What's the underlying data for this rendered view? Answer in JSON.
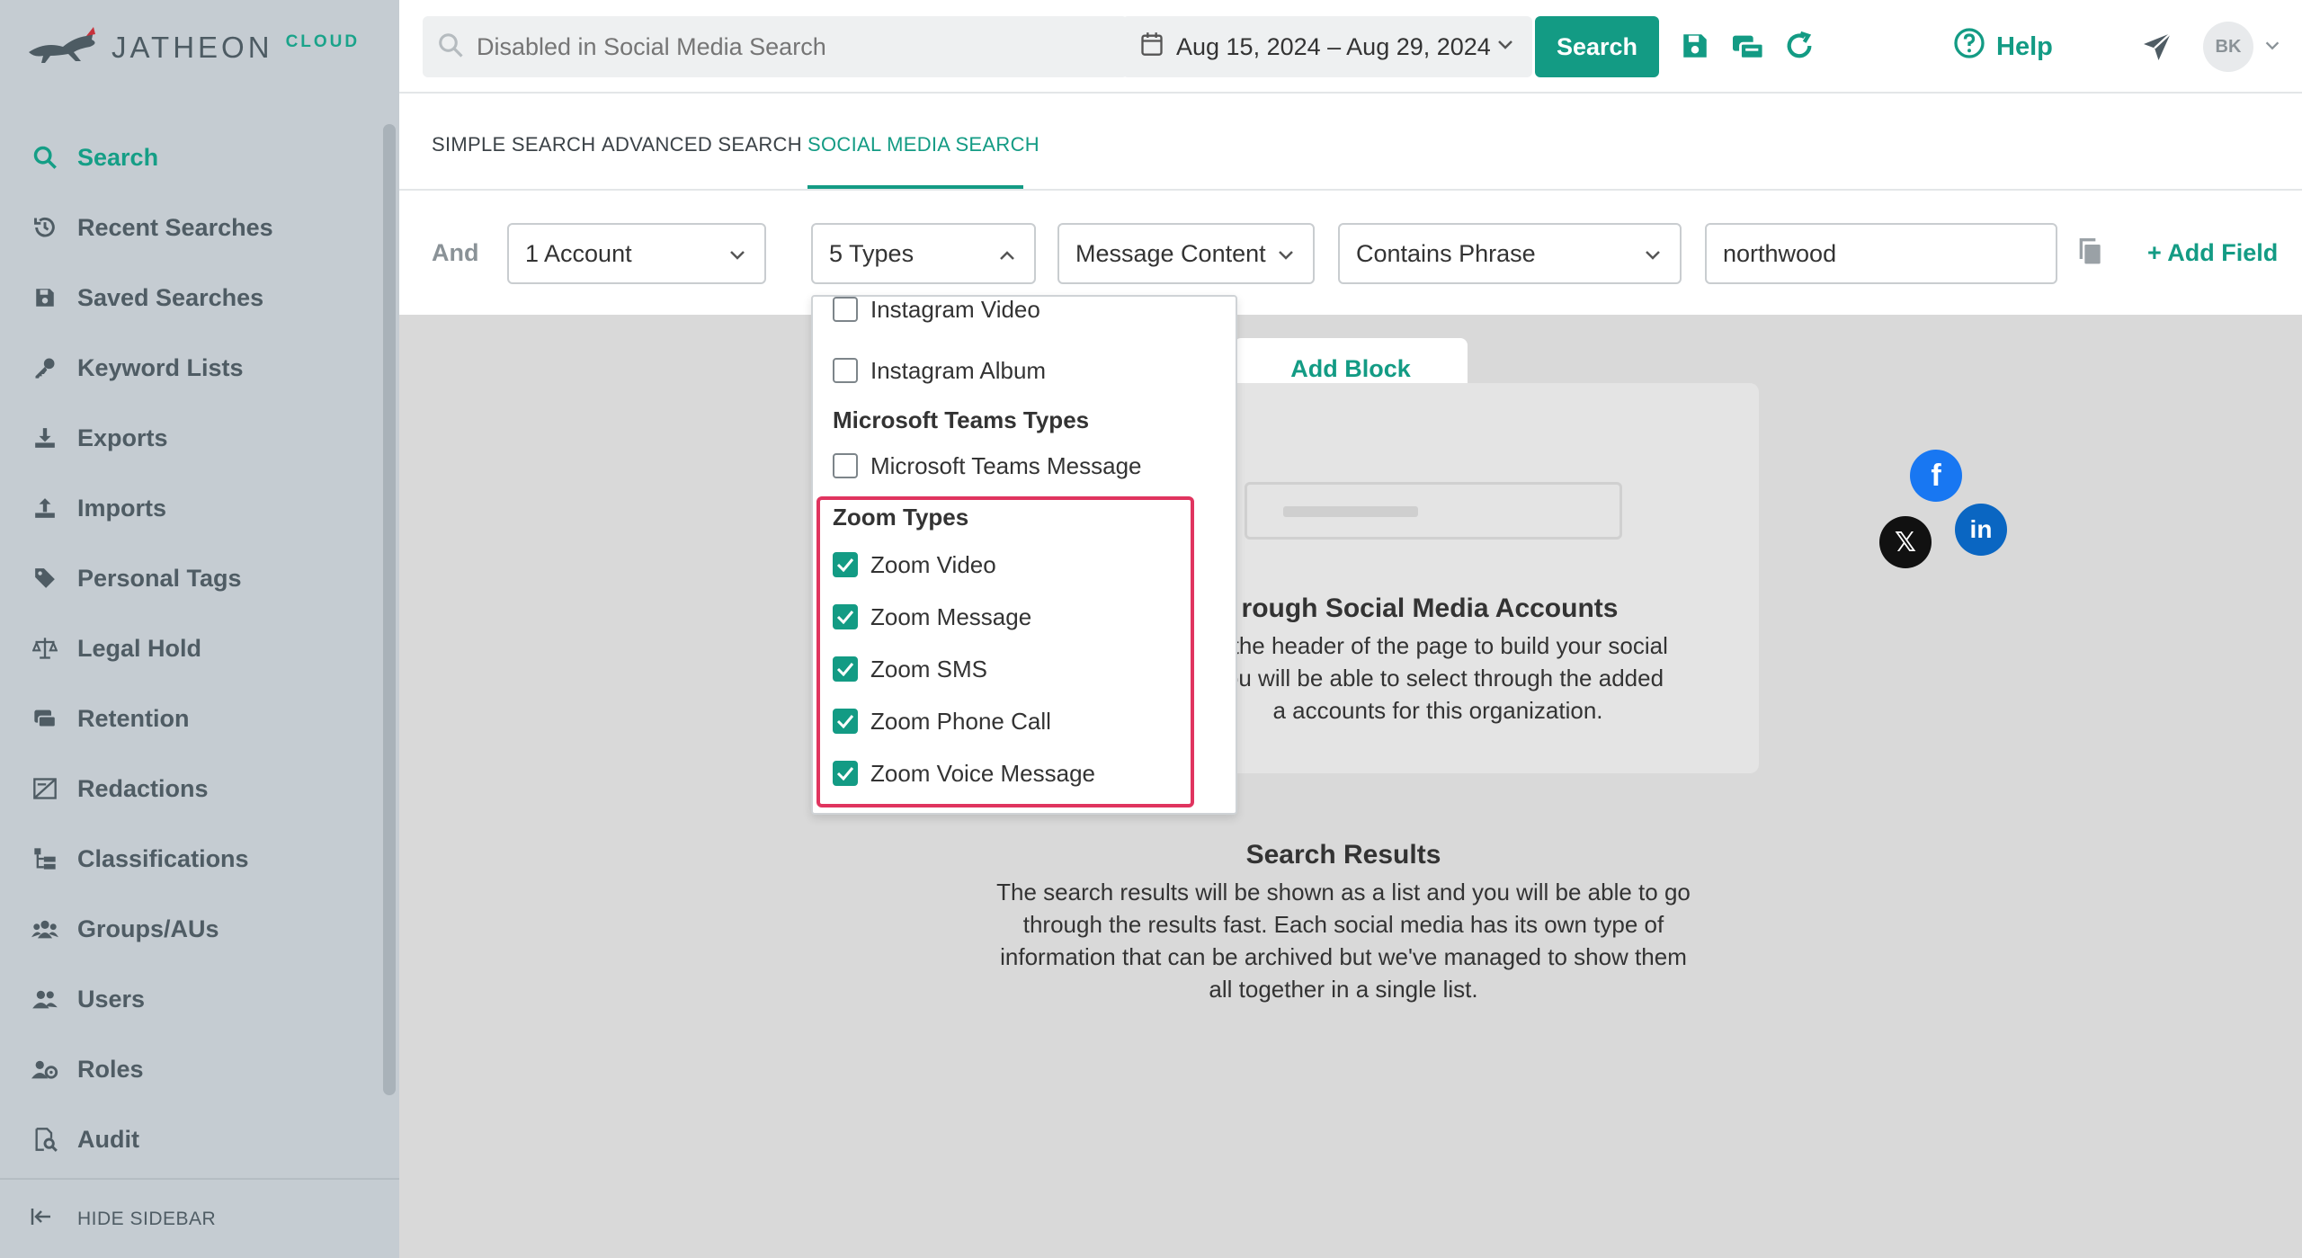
{
  "brand": {
    "name": "JATHEON",
    "sub": "CLOUD"
  },
  "sidebar": {
    "items": [
      {
        "label": "Search",
        "icon": "search-icon",
        "active": true
      },
      {
        "label": "Recent Searches",
        "icon": "history-icon"
      },
      {
        "label": "Saved Searches",
        "icon": "save-icon"
      },
      {
        "label": "Keyword Lists",
        "icon": "key-icon"
      },
      {
        "label": "Exports",
        "icon": "download-icon"
      },
      {
        "label": "Imports",
        "icon": "upload-icon"
      },
      {
        "label": "Personal Tags",
        "icon": "tag-icon"
      },
      {
        "label": "Legal Hold",
        "icon": "scale-icon"
      },
      {
        "label": "Retention",
        "icon": "retention-icon"
      },
      {
        "label": "Redactions",
        "icon": "redaction-icon"
      },
      {
        "label": "Classifications",
        "icon": "classification-icon"
      },
      {
        "label": "Groups/AUs",
        "icon": "groups-icon"
      },
      {
        "label": "Users",
        "icon": "users-icon"
      },
      {
        "label": "Roles",
        "icon": "roles-icon"
      },
      {
        "label": "Audit",
        "icon": "audit-icon"
      }
    ],
    "hide_label": "HIDE SIDEBAR"
  },
  "topbar": {
    "search_placeholder": "Disabled in Social Media Search",
    "date_range": "Aug 15, 2024 – Aug 29, 2024",
    "search_button": "Search",
    "help_label": "Help",
    "avatar_initials": "BK"
  },
  "tabs": [
    {
      "label": "SIMPLE SEARCH"
    },
    {
      "label": "ADVANCED SEARCH"
    },
    {
      "label": "SOCIAL MEDIA SEARCH",
      "active": true
    }
  ],
  "filters": {
    "and_label": "And",
    "account": "1 Account",
    "types": "5 Types",
    "field": "Message Content",
    "operator": "Contains Phrase",
    "value": "northwood",
    "add_field": "+ Add Field"
  },
  "dropdown": {
    "items": [
      {
        "label": "Instagram Video",
        "checked": false
      },
      {
        "label": "Instagram Album",
        "checked": false
      }
    ],
    "groups": [
      {
        "title": "Microsoft Teams Types",
        "items": [
          {
            "label": "Microsoft Teams Message",
            "checked": false
          }
        ]
      },
      {
        "title": "Zoom Types",
        "items": [
          {
            "label": "Zoom Video",
            "checked": true
          },
          {
            "label": "Zoom Message",
            "checked": true
          },
          {
            "label": "Zoom SMS",
            "checked": true
          },
          {
            "label": "Zoom Phone Call",
            "checked": true
          },
          {
            "label": "Zoom Voice Message",
            "checked": true
          }
        ]
      }
    ]
  },
  "main": {
    "add_block": "Add Block",
    "card_title": "rough Social Media Accounts",
    "card_text_1": "in the header of the page to build your social",
    "card_text_2": "You will be able to select through the added",
    "card_text_3": "a accounts for this organization.",
    "results_title": "Search Results",
    "results_text_1": "The search results will be shown as a list and you will be able to go",
    "results_text_2": "through the results fast. Each social media has its own type of",
    "results_text_3": "information that can be archived but we've managed to show them",
    "results_text_4": "all together in a single list."
  },
  "colors": {
    "accent": "#139b84",
    "highlight": "#e0345f",
    "sidebar": "#c5ccd2",
    "facebook": "#1877f2",
    "linkedin": "#0a66c2",
    "x": "#111111"
  }
}
